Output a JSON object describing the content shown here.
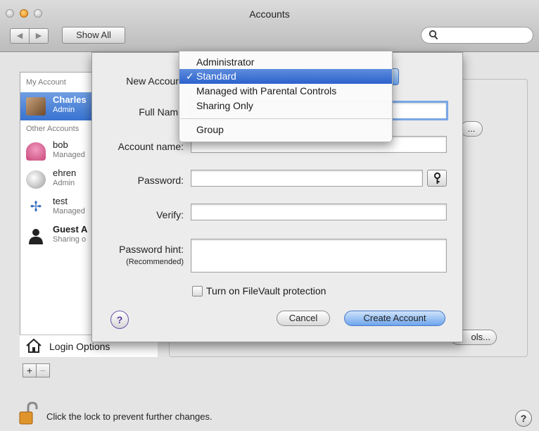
{
  "window": {
    "title": "Accounts"
  },
  "toolbar": {
    "back_label": "◀",
    "forward_label": "▶",
    "show_all_label": "Show All",
    "search_icon": "magnifier"
  },
  "sidebar": {
    "my_account_header": "My Account",
    "other_accounts_header": "Other Accounts",
    "users": [
      {
        "name": "Charles",
        "role": "Admin"
      },
      {
        "name": "bob",
        "role": "Managed"
      },
      {
        "name": "ehren",
        "role": "Admin"
      },
      {
        "name": "test",
        "role": "Managed"
      },
      {
        "name": "Guest A",
        "role": "Sharing o"
      }
    ],
    "login_options_label": "Login Options",
    "add_label": "+",
    "remove_label": "−"
  },
  "background_buttons": {
    "dots_label": "...",
    "tools_label": "ols..."
  },
  "footer": {
    "lock_message": "Click the lock to prevent further changes.",
    "help_label": "?"
  },
  "sheet": {
    "new_account_label": "New Account",
    "full_name_label": "Full Name",
    "account_name_label": "Account name:",
    "password_label": "Password:",
    "verify_label": "Verify:",
    "password_hint_label": "Password hint:",
    "password_hint_sub": "(Recommended)",
    "password_assistant_icon": "key",
    "filevault_label": "Turn on FileVault protection",
    "help_label": "?",
    "cancel_label": "Cancel",
    "create_label": "Create Account",
    "full_name_value": "",
    "account_name_value": "",
    "password_value": "",
    "verify_value": "",
    "hint_value": ""
  },
  "account_type_menu": {
    "selected": "Standard",
    "check": "✓",
    "items": [
      "Administrator",
      "Standard",
      "Managed with Parental Controls",
      "Sharing Only",
      "Group"
    ]
  },
  "colors": {
    "highlight": "#3873d1",
    "focus_ring": "#78a7e6"
  }
}
